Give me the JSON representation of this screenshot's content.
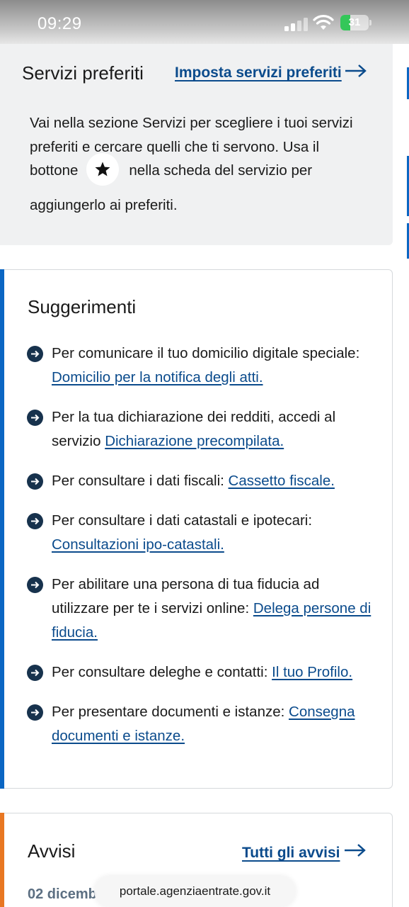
{
  "status_bar": {
    "time": "09:29",
    "battery": "31"
  },
  "favorites": {
    "title": "Servizi preferiti",
    "link_label": "Imposta servizi preferiti",
    "text_line1": "Vai nella sezione Servizi per scegliere i tuoi servizi",
    "text_line2": "preferiti e cercare quelli che ti servono. Usa il",
    "text_before_star": "bottone",
    "text_after_star": "nella scheda del servizio per",
    "text_line4": "aggiungerlo ai preferiti."
  },
  "suggestions": {
    "title": "Suggerimenti",
    "items": [
      {
        "text": "Per comunicare il tuo domicilio digitale speciale:",
        "link": "Domicilio per la notifica degli atti."
      },
      {
        "text": "Per la tua dichiarazione dei redditi, accedi al servizio",
        "link": "Dichiarazione precompilata."
      },
      {
        "text": "Per consultare i dati fiscali:",
        "link": "Cassetto fiscale."
      },
      {
        "text": "Per consultare i dati catastali e ipotecari:",
        "link": "Consultazioni ipo-catastali."
      },
      {
        "text": "Per abilitare una persona di tua fiducia ad utilizzare per te i servizi online:",
        "link": "Delega persone di fiducia."
      },
      {
        "text": "Per consultare deleghe e contatti:",
        "link": "Il tuo Profilo."
      },
      {
        "text": "Per presentare documenti e istanze:",
        "link": "Consegna documenti e istanze."
      }
    ]
  },
  "notices": {
    "title": "Avvisi",
    "link_label": "Tutti gli avvisi",
    "first_date": "02 dicemb"
  },
  "browser": {
    "url": "portale.agenziaentrate.gov.it"
  },
  "colors": {
    "link": "#0b4b8c",
    "primary_accent": "#0b66c3",
    "notice_accent": "#e87722",
    "bullet": "#17324d"
  }
}
